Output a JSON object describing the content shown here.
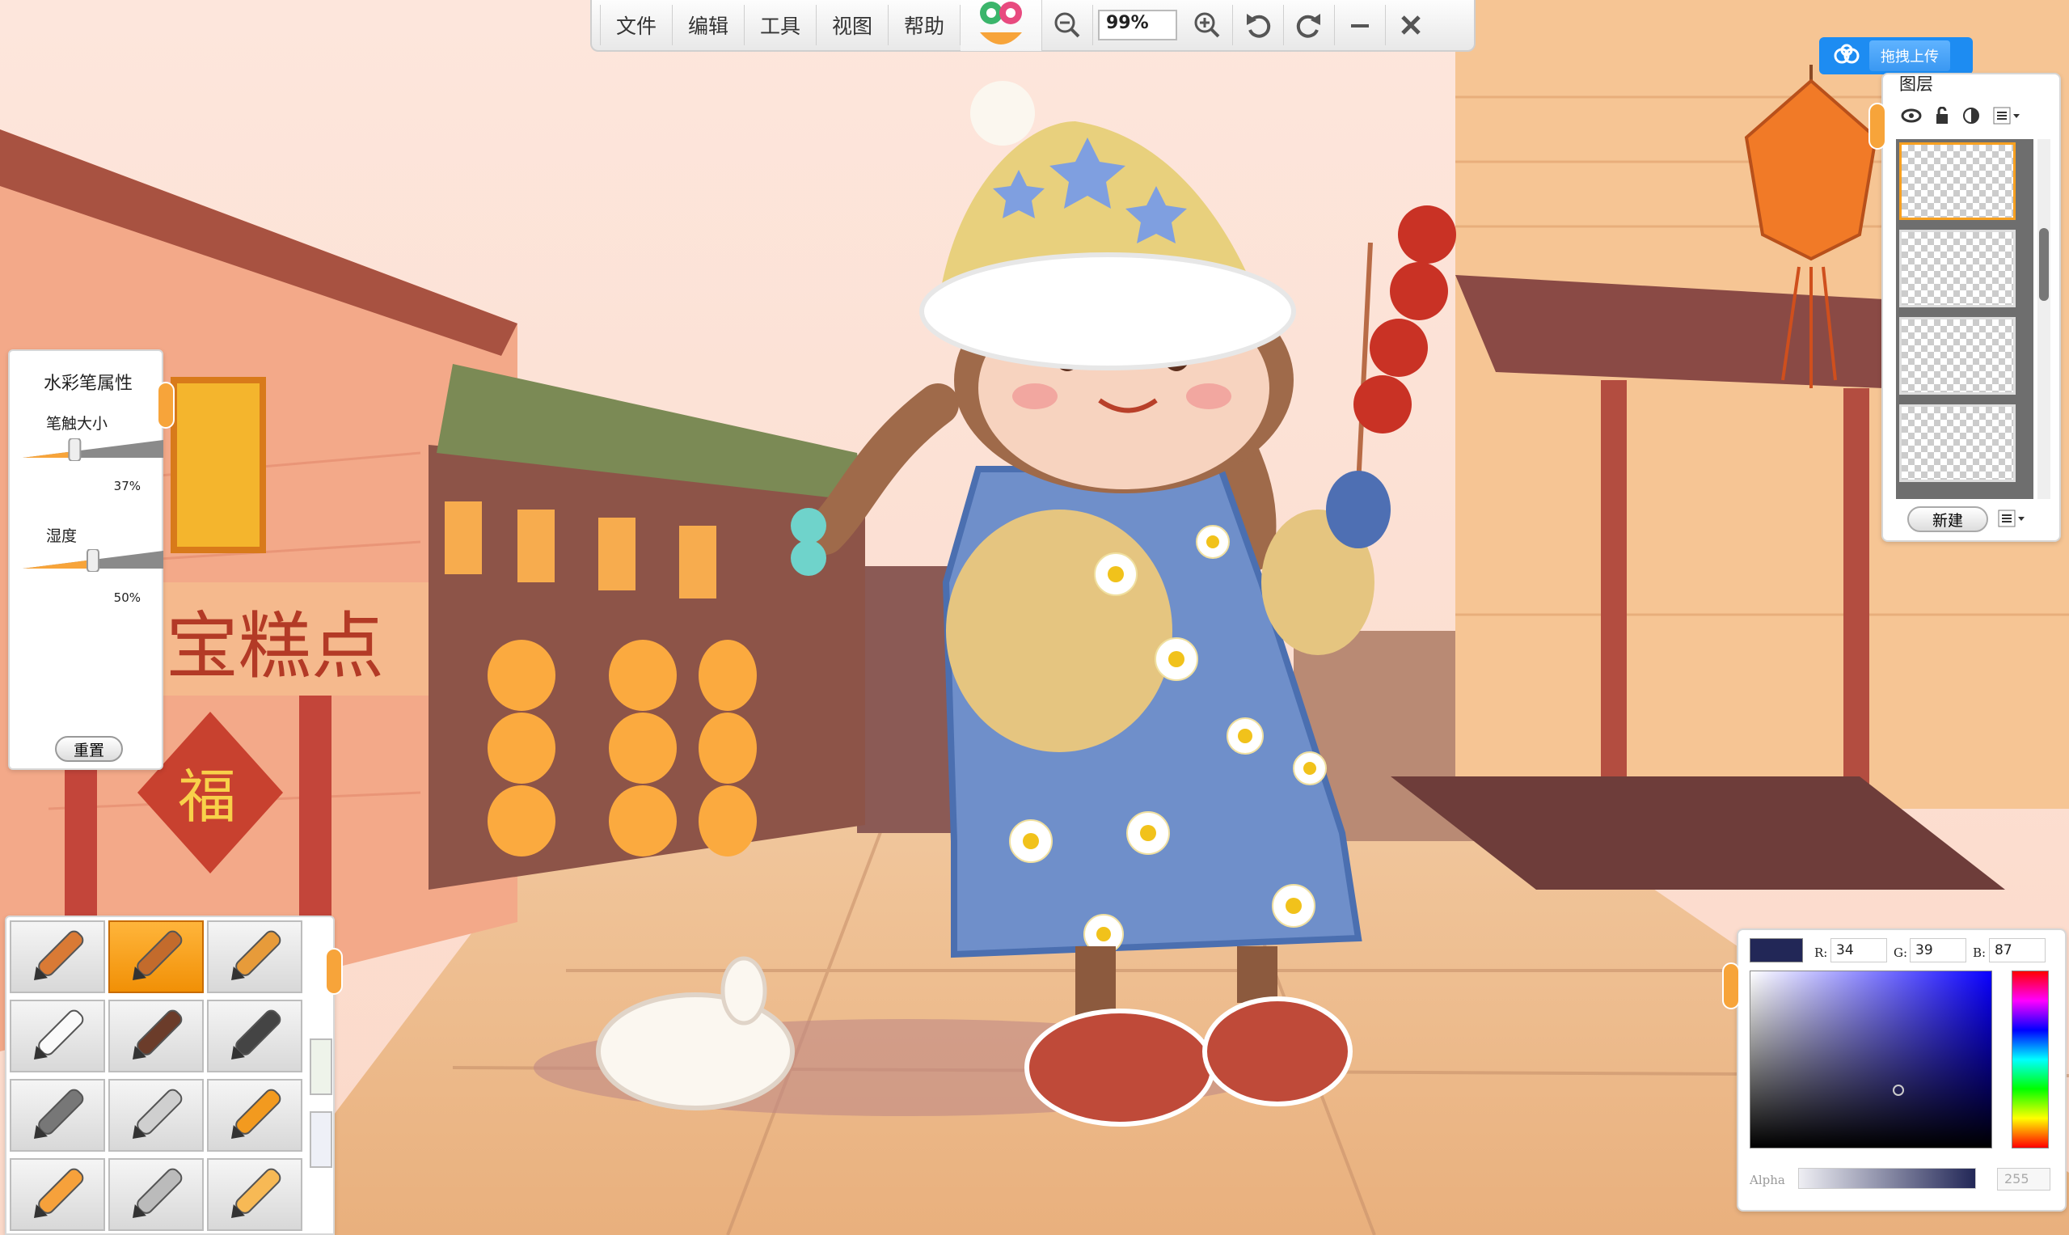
{
  "toolbar": {
    "menus": [
      "文件",
      "编辑",
      "工具",
      "视图",
      "帮助"
    ],
    "zoom_value": "99%"
  },
  "upload": {
    "label": "拖拽上传"
  },
  "brush_panel": {
    "title": "水彩笔属性",
    "size_label": "笔触大小",
    "size_value": "37%",
    "size_fraction": 0.37,
    "wetness_label": "湿度",
    "wetness_value": "50%",
    "wetness_fraction": 0.5,
    "reset_label": "重置"
  },
  "layers": {
    "title": "图层",
    "new_label": "新建",
    "count": 4,
    "selected_index": 0
  },
  "tools": {
    "items": [
      "pencil",
      "watercolor-brush",
      "marker",
      "eraser",
      "flat-brush",
      "ink-brush",
      "airbrush",
      "palette-knife",
      "roller",
      "crayon",
      "fan-brush",
      "highlighter"
    ],
    "selected": "watercolor-brush"
  },
  "color_picker": {
    "r_label": "R:",
    "r_value": "34",
    "g_label": "G:",
    "g_value": "39",
    "b_label": "B:",
    "b_value": "87",
    "swatch": "#222757",
    "alpha_label": "Alpha",
    "alpha_value": "255"
  },
  "canvas": {
    "shop_sign": "宝糕点",
    "fu_char": "福"
  },
  "colors": {
    "accent": "#f7a43a",
    "upload_blue": "#1d8cf2"
  }
}
